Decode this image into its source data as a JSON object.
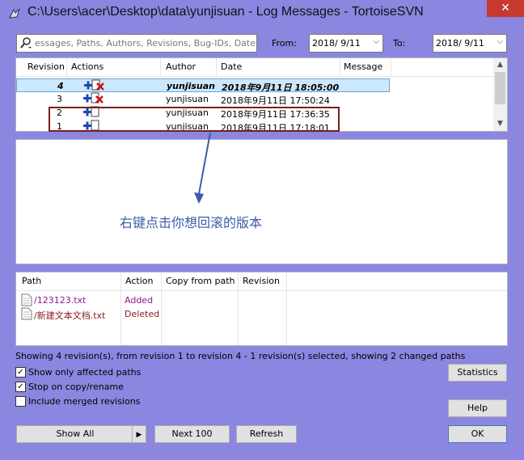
{
  "window": {
    "title": "C:\\Users\\acer\\Desktop\\data\\yunjisuan - Log Messages - TortoiseSVN",
    "close_glyph": "✕"
  },
  "filter": {
    "search_placeholder": "essages, Paths, Authors, Revisions, Bug-IDs, Date,",
    "from_label": "From:",
    "from_value": "2018/ 9/11",
    "to_label": "To:",
    "to_value": "2018/ 9/11"
  },
  "log": {
    "columns": [
      "Revision",
      "Actions",
      "Author",
      "Date",
      "Message"
    ],
    "rows": [
      {
        "revision": "4",
        "actions": [
          "added",
          "deleted"
        ],
        "author": "yunjisuan",
        "date": "2018年9月11日 18:05:00",
        "message": "",
        "selected": true
      },
      {
        "revision": "3",
        "actions": [
          "added",
          "deleted"
        ],
        "author": "yunjisuan",
        "date": "2018年9月11日 17:50:24",
        "message": ""
      },
      {
        "revision": "2",
        "actions": [
          "added"
        ],
        "author": "yunjisuan",
        "date": "2018年9月11日 17:36:35",
        "message": ""
      },
      {
        "revision": "1",
        "actions": [
          "added"
        ],
        "author": "yunjisuan",
        "date": "2018年9月11日 17:18:01",
        "message": ""
      }
    ]
  },
  "annotation": {
    "text": "右键点击你想回滚的版本",
    "color": "#3b5ba8",
    "box_color": "#7a1d1d"
  },
  "paths": {
    "columns": [
      "Path",
      "Action",
      "Copy from path",
      "Revision"
    ],
    "rows": [
      {
        "path": "/123123.txt",
        "action": "Added"
      },
      {
        "path": "/新建文本文档.txt",
        "action": "Deleted"
      }
    ]
  },
  "status_text": "Showing 4 revision(s), from revision 1 to revision 4 - 1 revision(s) selected, showing 2 changed paths",
  "options": [
    {
      "label": "Show only affected paths",
      "checked": true
    },
    {
      "label": "Stop on copy/rename",
      "checked": true
    },
    {
      "label": "Include merged revisions",
      "checked": false
    }
  ],
  "buttons": {
    "statistics": "Statistics",
    "help": "Help",
    "show_all": "Show All",
    "next_100": "Next 100",
    "refresh": "Refresh",
    "ok": "OK"
  },
  "colors": {
    "window_bg": "#8b86e0",
    "selected_row": "#cce8ff",
    "added": "#8a1b8a",
    "deleted": "#8a1b1b"
  }
}
